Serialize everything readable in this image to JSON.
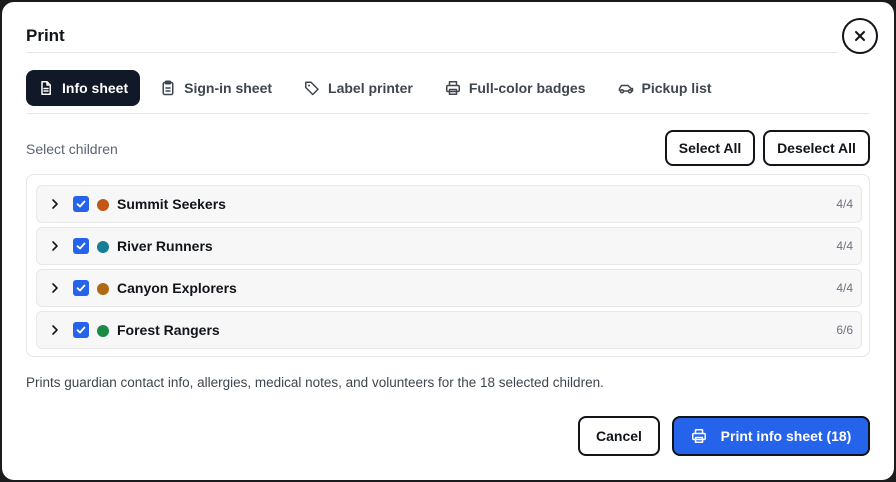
{
  "dialog": {
    "title": "Print",
    "close_icon": "close-icon"
  },
  "tabs": [
    {
      "label": "Info sheet",
      "icon": "document-icon",
      "active": true
    },
    {
      "label": "Sign-in sheet",
      "icon": "clipboard-icon",
      "active": false
    },
    {
      "label": "Label printer",
      "icon": "tag-icon",
      "active": false
    },
    {
      "label": "Full-color badges",
      "icon": "printer-icon",
      "active": false
    },
    {
      "label": "Pickup list",
      "icon": "car-icon",
      "active": false
    }
  ],
  "selection": {
    "label": "Select children",
    "select_all_label": "Select All",
    "deselect_all_label": "Deselect All"
  },
  "groups": [
    {
      "name": "Summit Seekers",
      "count": "4/4",
      "color": "#c2571a",
      "checked": true
    },
    {
      "name": "River Runners",
      "count": "4/4",
      "color": "#157e96",
      "checked": true
    },
    {
      "name": "Canyon Explorers",
      "count": "4/4",
      "color": "#b06a13",
      "checked": true
    },
    {
      "name": "Forest Rangers",
      "count": "6/6",
      "color": "#1a8a45",
      "checked": true
    }
  ],
  "footer": {
    "description": "Prints guardian contact info, allergies, medical notes, and volunteers for the 18 selected children.",
    "cancel_label": "Cancel",
    "print_label": "Print info sheet (18)"
  },
  "colors": {
    "accent": "#2563eb",
    "active_tab": "#111827"
  }
}
